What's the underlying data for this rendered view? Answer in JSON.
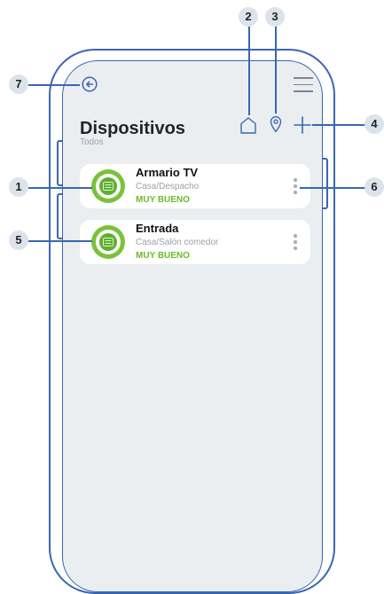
{
  "header": {
    "title": "Dispositivos",
    "subtitle": "Todos"
  },
  "icons": {
    "back": "back-arrow-icon",
    "menu": "hamburger-menu-icon",
    "home": "home-icon",
    "location": "location-pin-icon",
    "add": "plus-icon"
  },
  "devices": [
    {
      "name": "Armario TV",
      "location": "Casa/Despacho",
      "status": "MUY BUENO"
    },
    {
      "name": "Entrada",
      "location": "Casa/Salón comedor",
      "status": "MUY BUENO"
    }
  ],
  "callouts": [
    "1",
    "2",
    "3",
    "4",
    "5",
    "6",
    "7"
  ],
  "colors": {
    "accent": "#3a66b0",
    "status_good": "#6abc2c",
    "screen_bg": "#ebeef1"
  }
}
